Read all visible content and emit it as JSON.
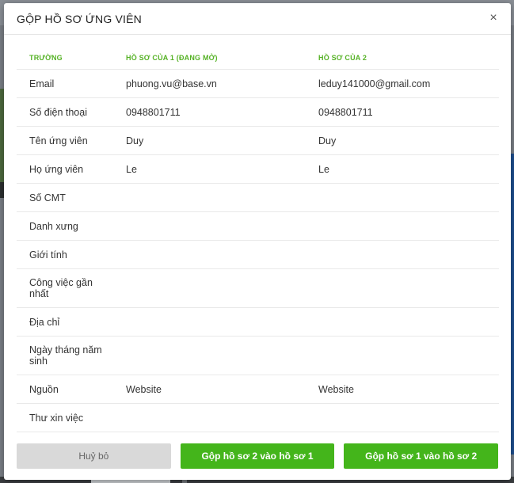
{
  "modal": {
    "title": "GỘP HỒ SƠ ỨNG VIÊN",
    "close_glyph": "×"
  },
  "table": {
    "headers": [
      "TRƯỜNG",
      "HỒ SƠ CỦA 1 (ĐANG MỞ)",
      "HỒ SƠ CỦA 2"
    ],
    "rows": [
      [
        "Email",
        "phuong.vu@base.vn",
        "leduy141000@gmail.com"
      ],
      [
        "Số điện thoại",
        "0948801711",
        "0948801711"
      ],
      [
        "Tên ứng viên",
        "Duy",
        "Duy"
      ],
      [
        "Họ ứng viên",
        "Le",
        "Le"
      ],
      [
        "Số CMT",
        "",
        ""
      ],
      [
        "Danh xưng",
        "",
        ""
      ],
      [
        "Giới tính",
        "",
        ""
      ],
      [
        "Công việc gần nhất",
        "",
        ""
      ],
      [
        "Địa chỉ",
        "",
        ""
      ],
      [
        "Ngày tháng năm sinh",
        "",
        ""
      ],
      [
        "Nguồn",
        "Website",
        "Website"
      ],
      [
        "Thư xin việc",
        "",
        ""
      ]
    ]
  },
  "footer": {
    "cancel_label": "Huỷ bỏ",
    "merge_2_into_1_label": "Gộp hồ sơ 2 vào hồ sơ 1",
    "merge_1_into_2_label": "Gộp hồ sơ 1 vào hồ sơ 2"
  },
  "colors": {
    "accent_green": "#44b51b",
    "header_green": "#56b226",
    "cancel_gray": "#d9d9d9"
  }
}
